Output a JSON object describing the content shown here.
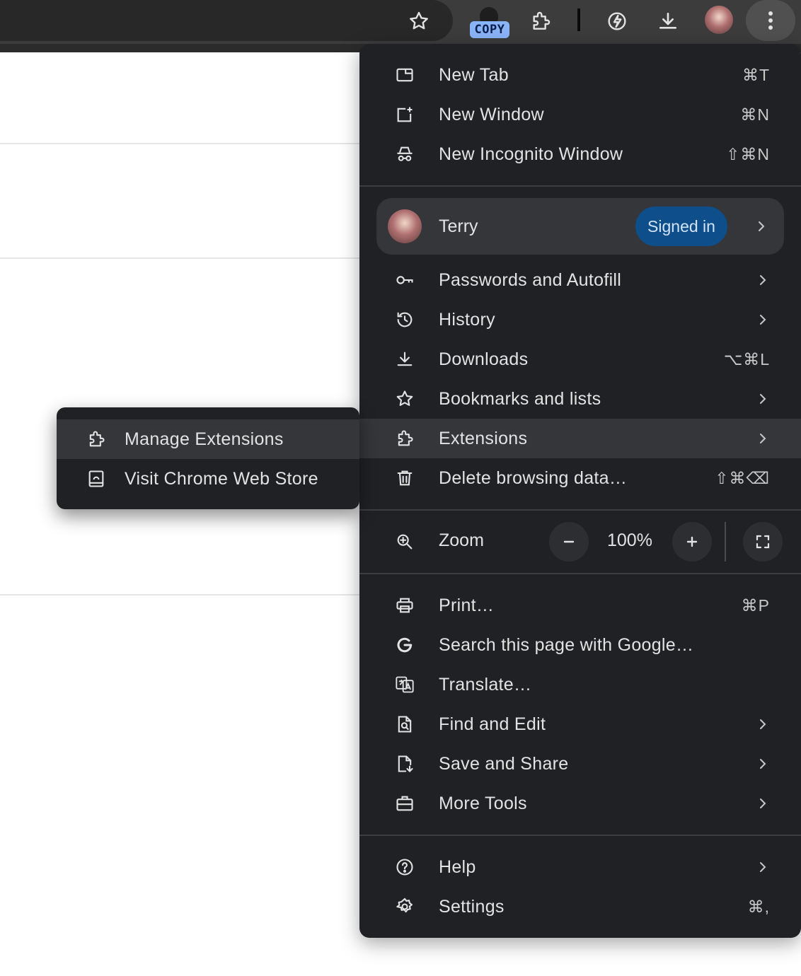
{
  "toolbar": {
    "icons": [
      "bookmark-star-icon",
      "copy-extension-icon",
      "extensions-puzzle-icon",
      "performance-leaf-icon",
      "download-icon",
      "profile-avatar",
      "kebab-menu-icon"
    ],
    "copy_badge": "COPY"
  },
  "menu": {
    "new_tab": {
      "label": "New Tab",
      "shortcut": "⌘T"
    },
    "new_window": {
      "label": "New Window",
      "shortcut": "⌘N"
    },
    "new_incognito": {
      "label": "New Incognito Window",
      "shortcut": "⇧⌘N"
    },
    "profile": {
      "name": "Terry",
      "status": "Signed in"
    },
    "passwords": {
      "label": "Passwords and Autofill"
    },
    "history": {
      "label": "History"
    },
    "downloads": {
      "label": "Downloads",
      "shortcut": "⌥⌘L"
    },
    "bookmarks": {
      "label": "Bookmarks and lists"
    },
    "extensions": {
      "label": "Extensions"
    },
    "delete_data": {
      "label": "Delete browsing data…",
      "shortcut": "⇧⌘⌫"
    },
    "zoom": {
      "label": "Zoom",
      "value": "100%"
    },
    "print": {
      "label": "Print…",
      "shortcut": "⌘P"
    },
    "search_google": {
      "label": "Search this page with Google…"
    },
    "translate": {
      "label": "Translate…"
    },
    "find_edit": {
      "label": "Find and Edit"
    },
    "save_share": {
      "label": "Save and Share"
    },
    "more_tools": {
      "label": "More Tools"
    },
    "help": {
      "label": "Help"
    },
    "settings": {
      "label": "Settings",
      "shortcut": "⌘,"
    }
  },
  "submenu": {
    "manage_extensions": {
      "label": "Manage Extensions"
    },
    "web_store": {
      "label": "Visit Chrome Web Store"
    }
  },
  "colors": {
    "menu_bg": "#202124",
    "highlight": "#35363a",
    "signed_in_badge": "#0d4e8b",
    "copy_badge": "#8ab4f8"
  }
}
